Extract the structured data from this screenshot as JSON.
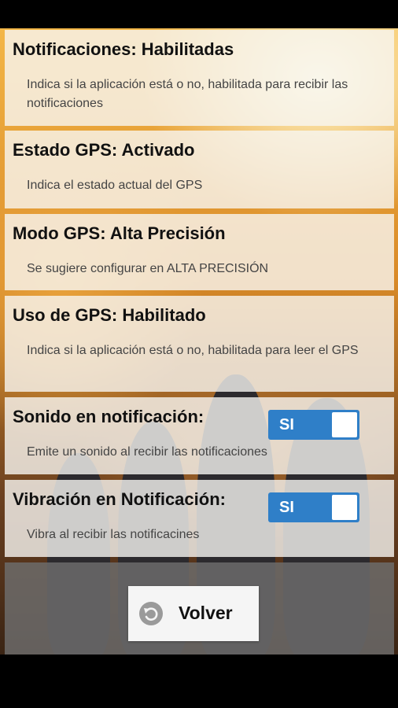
{
  "settings": [
    {
      "title": "Notificaciones: Habilitadas",
      "description": "Indica si la aplicación está o no, habilitada para recibir las notificaciones"
    },
    {
      "title": "Estado GPS: Activado",
      "description": "Indica el estado actual del GPS"
    },
    {
      "title": "Modo GPS: Alta Precisión",
      "description": "Se sugiere configurar en ALTA PRECISIÓN"
    },
    {
      "title": "Uso de GPS: Habilitado",
      "description": "Indica si la aplicación está o no, habilitada para leer el GPS"
    },
    {
      "title": "Sonido en notificación:",
      "description": "Emite un sonido al recibir las notificaciones",
      "toggle": "SI"
    },
    {
      "title": "Vibración en Notificación:",
      "description": "Vibra al recibir las notificacines",
      "toggle": "SI"
    }
  ],
  "footer": {
    "back_label": "Volver",
    "back_icon": "undo-icon"
  },
  "colors": {
    "toggle_on": "#2f7fc8"
  }
}
